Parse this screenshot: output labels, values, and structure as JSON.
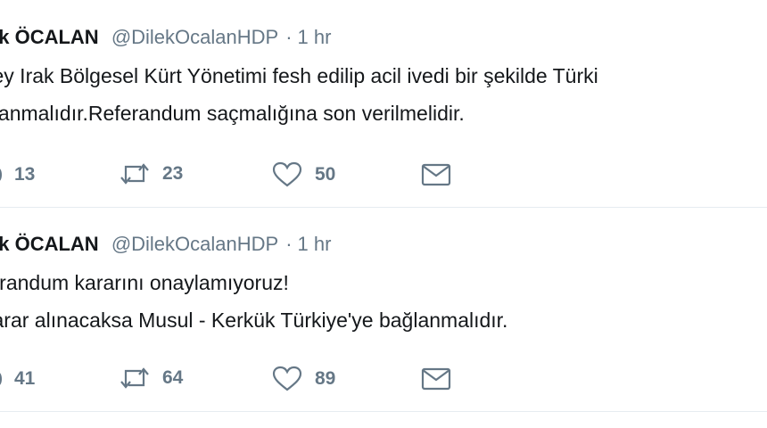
{
  "tweets": [
    {
      "name": "ek ÖCALAN",
      "handle": "@DilekOcalanHDP",
      "time": "1 hr",
      "lines": [
        "zey Irak Bölgesel Kürt Yönetimi fesh edilip acil ivedi bir şekilde Türki",
        "ğlanmalıdır.Referandum saçmalığına son verilmelidir."
      ],
      "replies": "13",
      "retweets": "23",
      "likes": "50"
    },
    {
      "name": "ek ÖCALAN",
      "handle": "@DilekOcalanHDP",
      "time": "1 hr",
      "lines": [
        "ferandum kararını onaylamıyoruz!",
        "karar alınacaksa Musul - Kerkük Türkiye'ye bağlanmalıdır."
      ],
      "replies": "41",
      "retweets": "64",
      "likes": "89"
    }
  ],
  "colors": {
    "text": "#14171a",
    "secondary": "#657786",
    "divider": "#e6ecf0"
  },
  "icons": [
    "reply-icon",
    "retweet-icon",
    "heart-icon",
    "envelope-icon"
  ]
}
